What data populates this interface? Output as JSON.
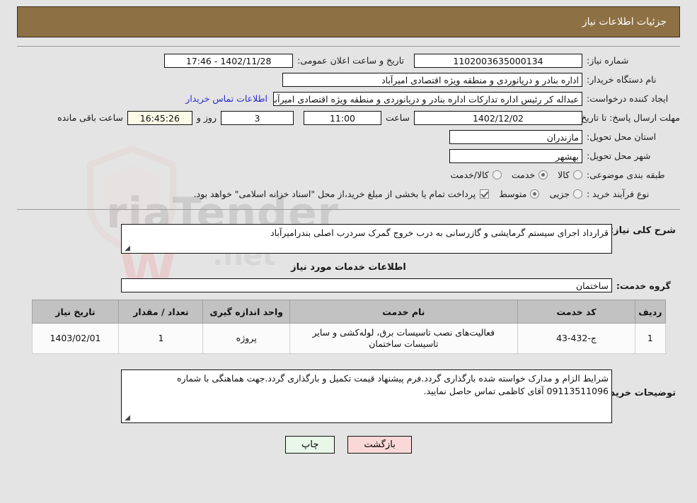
{
  "header": {
    "title": "جزئیات اطلاعات نیاز",
    "bar_color": "#8d7043"
  },
  "watermark": {
    "brand": "AriaTender",
    "suffix": ".net",
    "letter": "W",
    "word": "Tender"
  },
  "form": {
    "need_number": {
      "label": "شماره نیاز:",
      "value": "1102003635000134"
    },
    "announce_datetime": {
      "label": "تاریخ و ساعت اعلان عمومی:",
      "value": "1402/11/28 - 17:46"
    },
    "buyer_org": {
      "label": "نام دستگاه خریدار:",
      "value": "اداره بنادر و دریانوردی و منطقه ویژه اقتصادی امیرآباد"
    },
    "request_creator": {
      "label": "ایجاد کننده درخواست:",
      "value": "عبداله کر رئیس اداره تدارکات اداره بنادر و دریانوردی و منطقه ویژه اقتصادی امیرآبا",
      "contact_link": "اطلاعات تماس خریدار"
    },
    "deadline": {
      "label": "مهلت ارسال پاسخ: تا تاریخ:",
      "date": "1402/12/02",
      "time_label": "ساعت",
      "time": "11:00",
      "days": "3",
      "days_label": "روز و",
      "remaining": "16:45:26",
      "remaining_label": "ساعت باقی مانده"
    },
    "province": {
      "label": "استان محل تحویل:",
      "value": "مازندران"
    },
    "city": {
      "label": "شهر محل تحویل:",
      "value": "بهشهر"
    },
    "subject_classification": {
      "label": "طبقه بندی موضوعی:",
      "options": [
        {
          "label": "کالا",
          "selected": false
        },
        {
          "label": "خدمت",
          "selected": true
        },
        {
          "label": "کالا/خدمت",
          "selected": false
        }
      ]
    },
    "purchase_process": {
      "label": "نوع فرآیند خرید :",
      "options": [
        {
          "label": "جزیی",
          "selected": false
        },
        {
          "label": "متوسط",
          "selected": true
        }
      ],
      "payment_note": "پرداخت تمام یا بخشی از مبلغ خرید،از محل \"اسناد خزانه اسلامی\" خواهد بود.",
      "payment_checked": true
    }
  },
  "description": {
    "label": "شرح کلی نیاز:",
    "value": "قرارداد اجرای سیستم گرمایشی و گازرسانی به درب خروج گمرک سردرب اصلی بندرامیرآباد"
  },
  "services_section": {
    "title": "اطلاعات خدمات مورد نیاز",
    "group": {
      "label": "گروه خدمت:",
      "value": "ساختمان"
    }
  },
  "table": {
    "columns": [
      "ردیف",
      "کد خدمت",
      "نام خدمت",
      "واحد اندازه گیری",
      "تعداد / مقدار",
      "تاریخ نیاز"
    ],
    "rows": [
      {
        "radif": "1",
        "code": "ج-432-43",
        "name": "فعالیت‌های نصب تاسیسات برق، لوله‌کشی و سایر تاسیسات ساختمان",
        "unit": "پروژه",
        "qty": "1",
        "date": "1403/02/01"
      }
    ]
  },
  "buyer_notes": {
    "label": "توضیحات خریدار:",
    "value": "شرایط الزام و مدارک خواسته شده بارگذاری گردد.فرم پیشنهاد قیمت تکمیل و بارگذاری گردد.جهت هماهنگی با شماره 09113511096 آقای کاظمی تماس حاصل نمایید."
  },
  "footer": {
    "print_label": "چاپ",
    "back_label": "بازگشت"
  }
}
